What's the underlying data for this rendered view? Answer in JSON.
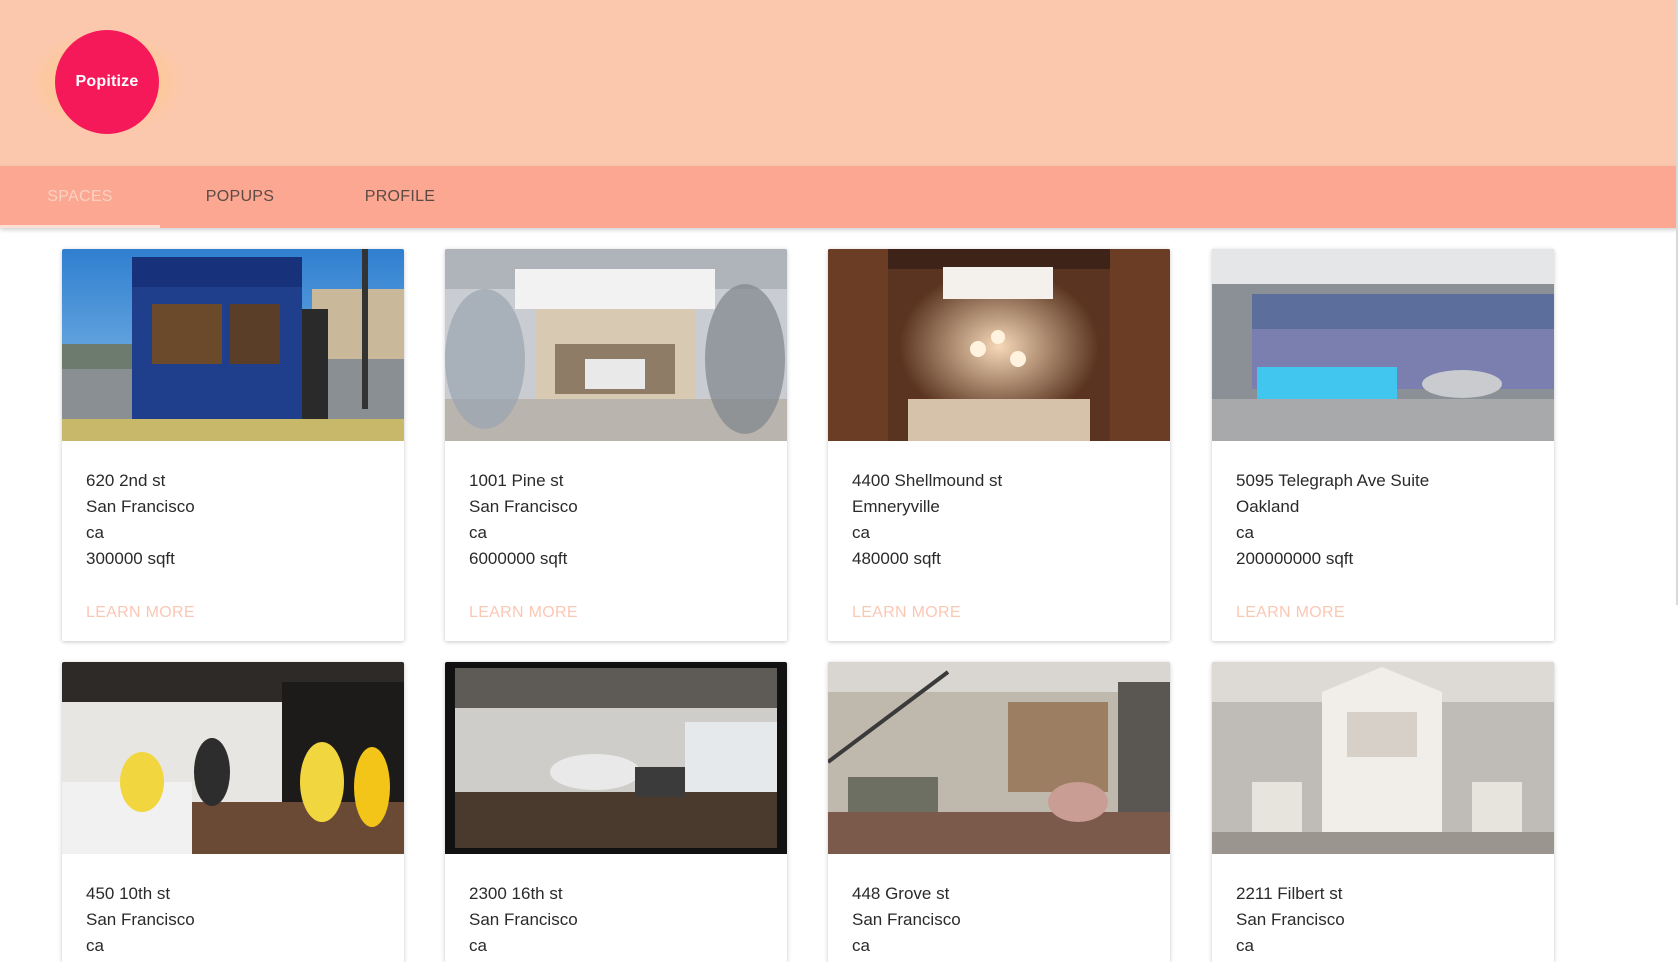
{
  "app": {
    "logo_text": "Popitize"
  },
  "nav": {
    "tabs": [
      {
        "label": "SPACES",
        "active": true
      },
      {
        "label": "POPUPS",
        "active": false
      },
      {
        "label": "PROFILE",
        "active": false
      }
    ]
  },
  "cards": [
    {
      "address": "620 2nd st",
      "city": "San Francisco",
      "state": "ca",
      "size": "300000 sqft",
      "action": "LEARN MORE",
      "image": "bagel-shop-container-image"
    },
    {
      "address": "1001 Pine st",
      "city": "San Francisco",
      "state": "ca",
      "size": "6000000 sqft",
      "action": "LEARN MORE",
      "image": "bmw-pop-up-shop-image"
    },
    {
      "address": "4400 Shellmound st",
      "city": "Emneryville",
      "state": "ca",
      "size": "480000 sqft",
      "action": "LEARN MORE",
      "image": "lounge-chandelier-image"
    },
    {
      "address": "5095 Telegraph Ave Suite",
      "city": "Oakland",
      "state": "ca",
      "size": "200000000 sqft",
      "action": "LEARN MORE",
      "image": "office-lobby-image"
    },
    {
      "address": "450 10th st",
      "city": "San Francisco",
      "state": "ca",
      "image": "retail-crowd-image"
    },
    {
      "address": "2300 16th st",
      "city": "San Francisco",
      "state": "ca",
      "image": "car-showroom-image"
    },
    {
      "address": "448 Grove st",
      "city": "San Francisco",
      "state": "ca",
      "image": "loft-interior-image"
    },
    {
      "address": "2211 Filbert st",
      "city": "San Francisco",
      "state": "ca",
      "image": "mall-kiosk-image"
    }
  ],
  "colors": {
    "header_bg": "#fbc8ae",
    "nav_bg": "#fca792",
    "logo_red": "#f5195a",
    "link_color": "#fbc7b5"
  }
}
